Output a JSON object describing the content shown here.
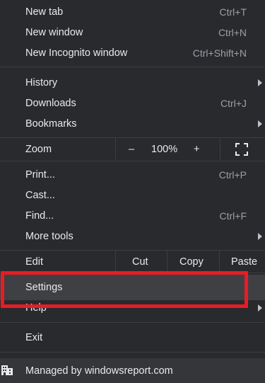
{
  "menu": {
    "new_tab": {
      "label": "New tab",
      "shortcut": "Ctrl+T"
    },
    "new_window": {
      "label": "New window",
      "shortcut": "Ctrl+N"
    },
    "new_incognito": {
      "label": "New Incognito window",
      "shortcut": "Ctrl+Shift+N"
    },
    "history": {
      "label": "History"
    },
    "downloads": {
      "label": "Downloads",
      "shortcut": "Ctrl+J"
    },
    "bookmarks": {
      "label": "Bookmarks"
    },
    "zoom": {
      "label": "Zoom",
      "minus": "–",
      "value": "100%",
      "plus": "+"
    },
    "print": {
      "label": "Print...",
      "shortcut": "Ctrl+P"
    },
    "cast": {
      "label": "Cast..."
    },
    "find": {
      "label": "Find...",
      "shortcut": "Ctrl+F"
    },
    "more_tools": {
      "label": "More tools"
    },
    "edit": {
      "label": "Edit",
      "cut": "Cut",
      "copy": "Copy",
      "paste": "Paste"
    },
    "settings": {
      "label": "Settings"
    },
    "help": {
      "label": "Help"
    },
    "exit": {
      "label": "Exit"
    },
    "managed": {
      "label": "Managed by windowsreport.com"
    }
  },
  "colors": {
    "background": "#292a2d",
    "text": "#e8eaed",
    "shortcut_text": "#9aa0a6",
    "highlight": "#3f4044",
    "annotation_red": "#e81c24"
  }
}
